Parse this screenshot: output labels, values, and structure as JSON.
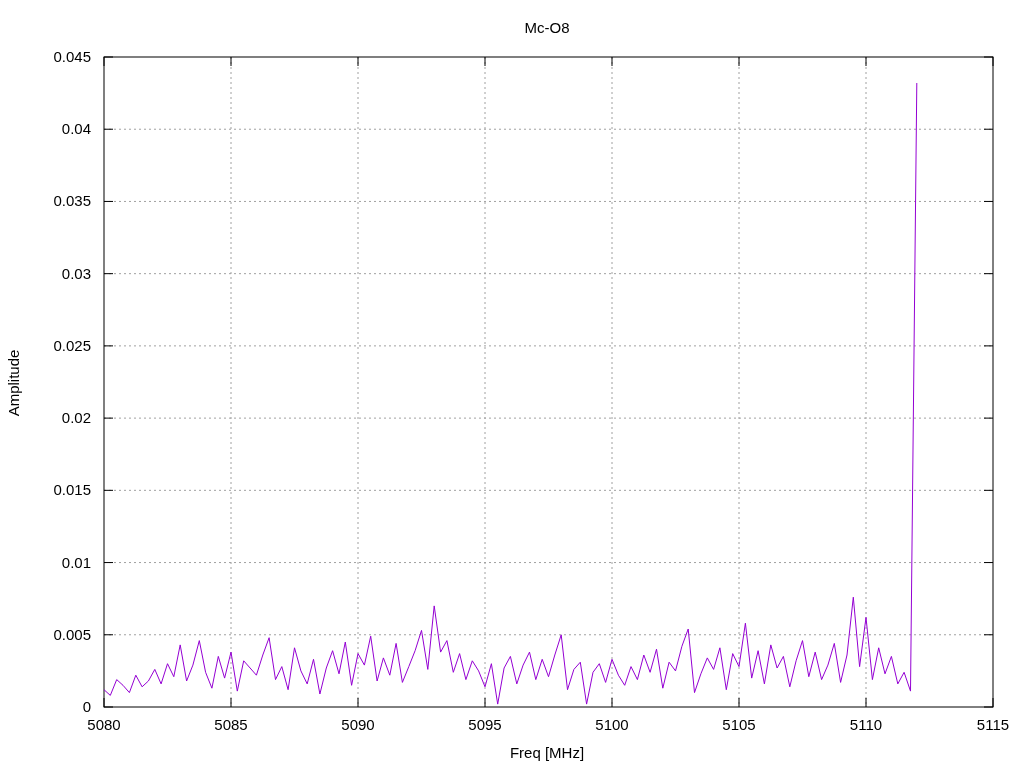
{
  "chart": {
    "chart_data": {
      "type": "line",
      "title": "Mc-O8",
      "xlabel": "Freq [MHz]",
      "ylabel": "Amplitude",
      "xlim": [
        5080,
        5115
      ],
      "ylim": [
        0,
        0.045
      ],
      "xticks": [
        5080,
        5085,
        5090,
        5095,
        5100,
        5105,
        5110,
        5115
      ],
      "yticks": [
        {
          "value": 0,
          "label": "0"
        },
        {
          "value": 0.005,
          "label": "0.005"
        },
        {
          "value": 0.01,
          "label": "0.01"
        },
        {
          "value": 0.015,
          "label": "0.015"
        },
        {
          "value": 0.02,
          "label": "0.02"
        },
        {
          "value": 0.025,
          "label": "0.025"
        },
        {
          "value": 0.03,
          "label": "0.03"
        },
        {
          "value": 0.035,
          "label": "0.035"
        },
        {
          "value": 0.04,
          "label": "0.04"
        },
        {
          "value": 0.045,
          "label": "0.045"
        }
      ],
      "grid": true,
      "x": [
        5080,
        5080.25,
        5080.5,
        5080.75,
        5081,
        5081.25,
        5081.5,
        5081.75,
        5082,
        5082.25,
        5082.5,
        5082.75,
        5083,
        5083.25,
        5083.5,
        5083.75,
        5084,
        5084.25,
        5084.5,
        5084.75,
        5085,
        5085.25,
        5085.5,
        5085.75,
        5086,
        5086.25,
        5086.5,
        5086.75,
        5087,
        5087.25,
        5087.5,
        5087.75,
        5088,
        5088.25,
        5088.5,
        5088.75,
        5089,
        5089.25,
        5089.5,
        5089.75,
        5090,
        5090.25,
        5090.5,
        5090.75,
        5091,
        5091.25,
        5091.5,
        5091.75,
        5092,
        5092.25,
        5092.5,
        5092.75,
        5093,
        5093.25,
        5093.5,
        5093.75,
        5094,
        5094.25,
        5094.5,
        5094.75,
        5095,
        5095.25,
        5095.5,
        5095.75,
        5096,
        5096.25,
        5096.5,
        5096.75,
        5097,
        5097.25,
        5097.5,
        5097.75,
        5098,
        5098.25,
        5098.5,
        5098.75,
        5099,
        5099.25,
        5099.5,
        5099.75,
        5100,
        5100.25,
        5100.5,
        5100.75,
        5101,
        5101.25,
        5101.5,
        5101.75,
        5102,
        5102.25,
        5102.5,
        5102.75,
        5103,
        5103.25,
        5103.5,
        5103.75,
        5104,
        5104.25,
        5104.5,
        5104.75,
        5105,
        5105.25,
        5105.5,
        5105.75,
        5106,
        5106.25,
        5106.5,
        5106.75,
        5107,
        5107.25,
        5107.5,
        5107.75,
        5108,
        5108.25,
        5108.5,
        5108.75,
        5109,
        5109.25,
        5109.5,
        5109.75,
        5110,
        5110.25,
        5110.5,
        5110.75,
        5111,
        5111.25,
        5111.5,
        5111.75,
        5112
      ],
      "series": [
        {
          "color": "#9400d3",
          "values": [
            0.0012,
            0.0008,
            0.0019,
            0.0015,
            0.001,
            0.0022,
            0.0014,
            0.0018,
            0.0026,
            0.0016,
            0.003,
            0.0021,
            0.0043,
            0.0018,
            0.0029,
            0.0046,
            0.0024,
            0.0013,
            0.0035,
            0.002,
            0.0038,
            0.0011,
            0.0032,
            0.0027,
            0.0022,
            0.0036,
            0.0048,
            0.0019,
            0.0028,
            0.0012,
            0.0041,
            0.0025,
            0.0016,
            0.0033,
            0.0009,
            0.0027,
            0.0039,
            0.0023,
            0.0045,
            0.0015,
            0.0037,
            0.0029,
            0.0049,
            0.0018,
            0.0034,
            0.0022,
            0.0044,
            0.0017,
            0.0028,
            0.0039,
            0.0053,
            0.0026,
            0.007,
            0.0038,
            0.0046,
            0.0024,
            0.0037,
            0.0019,
            0.0032,
            0.0025,
            0.0014,
            0.003,
            0.0002,
            0.0027,
            0.0035,
            0.0016,
            0.0029,
            0.0038,
            0.0019,
            0.0033,
            0.0021,
            0.0036,
            0.005,
            0.0012,
            0.0026,
            0.0031,
            0.0002,
            0.0024,
            0.003,
            0.0017,
            0.0033,
            0.0022,
            0.0015,
            0.0028,
            0.0019,
            0.0036,
            0.0024,
            0.004,
            0.0013,
            0.0031,
            0.0025,
            0.0042,
            0.0054,
            0.001,
            0.0023,
            0.0034,
            0.0026,
            0.0041,
            0.0012,
            0.0037,
            0.0028,
            0.0058,
            0.002,
            0.0039,
            0.0016,
            0.0043,
            0.0027,
            0.0035,
            0.0014,
            0.0032,
            0.0046,
            0.0021,
            0.0038,
            0.0019,
            0.0029,
            0.0044,
            0.0017,
            0.0036,
            0.0076,
            0.0028,
            0.0062,
            0.0019,
            0.0041,
            0.0023,
            0.0035,
            0.0016,
            0.0024,
            0.0011,
            0.0432
          ]
        }
      ]
    }
  }
}
